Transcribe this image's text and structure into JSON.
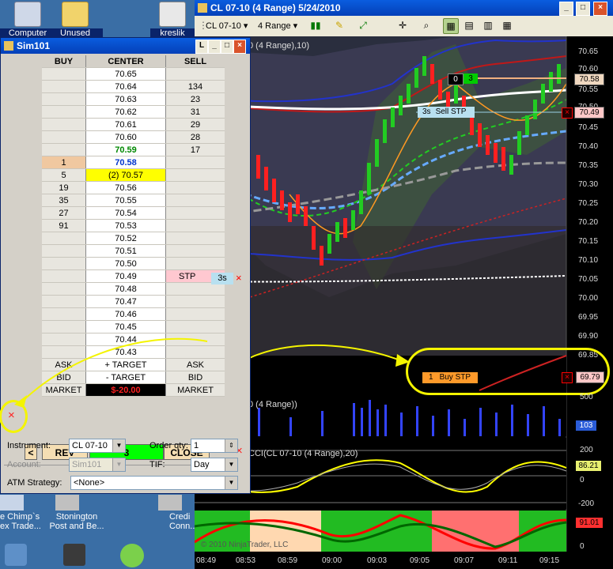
{
  "desktop": {
    "icons": [
      {
        "label": "Computer"
      },
      {
        "label": "Unused"
      },
      {
        "label": "kreslik"
      }
    ],
    "shortcuts": [
      {
        "label": "e Chimp`s\nex Trade..."
      },
      {
        "label": "Stonington\nPost and Be..."
      },
      {
        "label": "Credi\nConn..."
      }
    ]
  },
  "chart_window": {
    "title": "CL 07-10 (4 Range)  5/24/2010",
    "toolbar": {
      "instrument": "CL 07-10",
      "period": "4 Range"
    },
    "overlay_label": "0 (4 Range),10)",
    "volume_label": "0 (4 Range))",
    "cci_label": "CCI(CL 07-10 (4 Range),20)",
    "copyright": "© 2010 NinjaTrader, LLC",
    "price_axis": [
      "70.65",
      "70.60",
      "70.55",
      "70.50",
      "70.45",
      "70.40",
      "70.35",
      "70.30",
      "70.25",
      "70.20",
      "70.15",
      "70.10",
      "70.05",
      "70.00",
      "69.95",
      "69.90",
      "69.85",
      "69.80",
      "69.75"
    ],
    "price_tags": {
      "last": "70.58",
      "sell_stop": "70.49",
      "buy_stop": "69.79"
    },
    "volume_axis": {
      "top": "500",
      "tag": "103"
    },
    "cci_axis": {
      "top": "200",
      "tag": "86.21",
      "zero": "0",
      "bottom": "-200"
    },
    "bottom_axis": {
      "tag": "91.01",
      "zero": "0"
    },
    "time_axis": [
      "08:49",
      "08:53",
      "08:59",
      "09:00",
      "09:03",
      "09:05",
      "09:07",
      "09:11",
      "09:15"
    ],
    "orders": {
      "position": {
        "qty": "0",
        "fill": "3"
      },
      "sell_stop": {
        "qty": "3s",
        "label": "Sell STP"
      },
      "buy_stop": {
        "qty": "1",
        "label": "Buy STP"
      }
    }
  },
  "dom_window": {
    "title": "Sim101",
    "headers": {
      "buy": "BUY",
      "center": "CENTER",
      "sell": "SELL"
    },
    "rows": [
      {
        "buy": "",
        "price": "70.65",
        "sell": ""
      },
      {
        "buy": "",
        "price": "70.64",
        "sell": "134"
      },
      {
        "buy": "",
        "price": "70.63",
        "sell": "23"
      },
      {
        "buy": "",
        "price": "70.62",
        "sell": "31"
      },
      {
        "buy": "",
        "price": "70.61",
        "sell": "29"
      },
      {
        "buy": "",
        "price": "70.60",
        "sell": "28"
      },
      {
        "buy": "",
        "price": "70.59",
        "sell": "17"
      },
      {
        "buy": "1",
        "price": "70.58",
        "sell": ""
      },
      {
        "buy": "5",
        "price": "(2) 70.57",
        "sell": ""
      },
      {
        "buy": "19",
        "price": "70.56",
        "sell": ""
      },
      {
        "buy": "35",
        "price": "70.55",
        "sell": ""
      },
      {
        "buy": "27",
        "price": "70.54",
        "sell": ""
      },
      {
        "buy": "91",
        "price": "70.53",
        "sell": ""
      },
      {
        "buy": "",
        "price": "70.52",
        "sell": ""
      },
      {
        "buy": "",
        "price": "70.51",
        "sell": ""
      },
      {
        "buy": "",
        "price": "70.50",
        "sell": ""
      },
      {
        "buy": "",
        "price": "70.49",
        "sell": "STP"
      },
      {
        "buy": "",
        "price": "70.48",
        "sell": ""
      },
      {
        "buy": "",
        "price": "70.47",
        "sell": ""
      },
      {
        "buy": "",
        "price": "70.46",
        "sell": ""
      },
      {
        "buy": "",
        "price": "70.45",
        "sell": ""
      },
      {
        "buy": "",
        "price": "70.44",
        "sell": ""
      },
      {
        "buy": "",
        "price": "70.43",
        "sell": ""
      }
    ],
    "stp_qty": "3s",
    "ask_row": {
      "left": "ASK",
      "center": "+ TARGET",
      "right": "ASK"
    },
    "bid_row": {
      "left": "BID",
      "center": "- TARGET",
      "right": "BID"
    },
    "market_row": {
      "left": "MARKET",
      "center": "$-20.00",
      "right": "MARKET"
    },
    "buttons": {
      "rev": "REV",
      "position": "3",
      "close": "CLOSE",
      "left_arrow": "<"
    },
    "form": {
      "instrument_label": "Instrument:",
      "instrument": "CL 07-10",
      "order_qty_label": "Order qty:",
      "order_qty": "1",
      "account_label": "Account:",
      "account": "Sim101",
      "tif_label": "TIF:",
      "tif": "Day",
      "atm_label": "ATM Strategy:",
      "atm": "<None>"
    }
  },
  "colors": {
    "accent_green": "#00ff00",
    "ask_sell_red": "#ff0000",
    "highlight_yellow": "#ffff00",
    "annotation_yellow": "#f4f400"
  }
}
